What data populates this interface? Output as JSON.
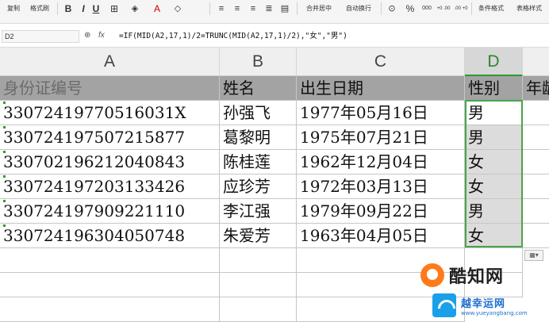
{
  "toolbar": {
    "copy": "复制",
    "format_painter": "格式刷",
    "bold": "B",
    "italic": "I",
    "underline": "U",
    "merge_center": "合并居中",
    "wrap_text": "自动换行",
    "percent": "%",
    "thousands": "000",
    "inc_decimal": "+0 .00",
    "dec_decimal": ".00 +0",
    "conditional_format": "条件格式",
    "table_style": "表格样式"
  },
  "formula_bar": {
    "name_box": "D2",
    "fx": "fx",
    "formula": "=IF(MID(A2,17,1)/2=TRUNC(MID(A2,17,1)/2),\"女\",\"男\")"
  },
  "columns": [
    "A",
    "B",
    "C",
    "D"
  ],
  "header_row": {
    "a": "身份证编号",
    "b": "姓名",
    "c": "出生日期",
    "d": "性别",
    "e": "年龄"
  },
  "rows": [
    {
      "id": "33072419770516031X",
      "name": "孙强飞",
      "birth": "1977年05月16日",
      "gender": "男"
    },
    {
      "id": "330724197507215877",
      "name": "葛黎明",
      "birth": "1975年07月21日",
      "gender": "男"
    },
    {
      "id": "330702196212040843",
      "name": "陈桂莲",
      "birth": "1962年12月04日",
      "gender": "女"
    },
    {
      "id": "330724197203133426",
      "name": "应珍芳",
      "birth": "1972年03月13日",
      "gender": "女"
    },
    {
      "id": "330724197909221110",
      "name": "李江强",
      "birth": "1979年09月22日",
      "gender": "男"
    },
    {
      "id": "330724196304050748",
      "name": "朱爱芳",
      "birth": "1963年04月05日",
      "gender": "女"
    }
  ],
  "watermark": {
    "brand1": "酷知网",
    "brand2": "越幸运网",
    "url": "www.yueyangbang.com"
  }
}
